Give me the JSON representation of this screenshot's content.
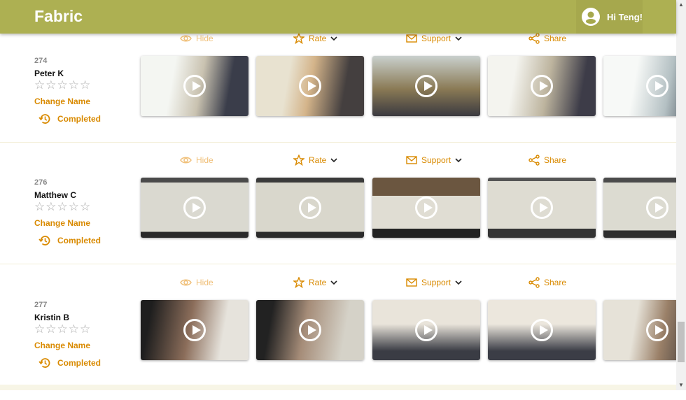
{
  "header": {
    "brand": "Fabric",
    "greeting": "Hi Teng!"
  },
  "actions": {
    "hide": "Hide",
    "rate": "Rate",
    "support": "Support",
    "share": "Share"
  },
  "colors": {
    "header": "#adb052",
    "accent": "#d98a00"
  },
  "participants": [
    {
      "id": "274",
      "name": "Peter K",
      "rating": 0,
      "change_name": "Change Name",
      "status": "Completed"
    },
    {
      "id": "276",
      "name": "Matthew C",
      "rating": 0,
      "change_name": "Change Name",
      "status": "Completed"
    },
    {
      "id": "277",
      "name": "Kristin B",
      "rating": 0,
      "change_name": "Change Name",
      "status": "Completed"
    }
  ]
}
